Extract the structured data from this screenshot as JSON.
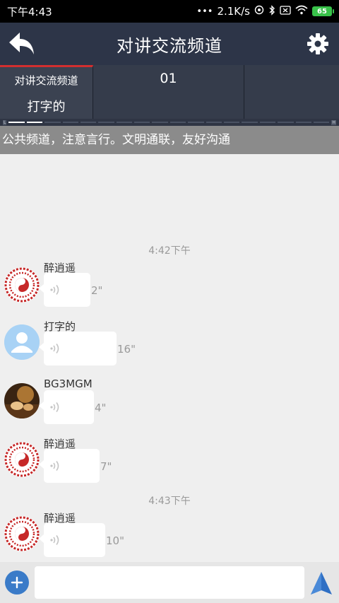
{
  "status_bar": {
    "time": "下午4:43",
    "dots": "•••",
    "speed": "2.1K/s",
    "battery": "65"
  },
  "header": {
    "title": "对讲交流频道",
    "back_icon": "back-arrow-icon",
    "settings_icon": "gear-icon"
  },
  "channels": [
    {
      "name": "对讲交流频道",
      "user": "打字的",
      "active": true
    },
    {
      "name": "01",
      "user": "",
      "active": false
    },
    {
      "name": "",
      "user": "",
      "active": false
    }
  ],
  "scroll_caps": {
    "left": "L",
    "right": "H"
  },
  "notice": "公共频道，注意言行。文明通联，友好沟通",
  "time_labels": [
    "4:42下午",
    "4:43下午"
  ],
  "messages": [
    {
      "name": "醉逍遥",
      "duration": "2\"",
      "avatar": "seal-avatar"
    },
    {
      "name": "打字的",
      "duration": "16\"",
      "avatar": "default-user-avatar"
    },
    {
      "name": "BG3MGM",
      "duration": "4\"",
      "avatar": "tea-photo-avatar"
    },
    {
      "name": "醉逍遥",
      "duration": "7\"",
      "avatar": "seal-avatar"
    },
    {
      "name": "醉逍遥",
      "duration": "10\"",
      "avatar": "seal-avatar"
    }
  ],
  "input": {
    "placeholder": "",
    "value": ""
  },
  "colors": {
    "header_bg": "#2d3548",
    "channel_bg": "#353c4b",
    "active_accent": "#d32f2f",
    "notice_bg": "#8b8b8b",
    "plus_button": "#3a7bc8",
    "send_button": "#2f6fc4"
  }
}
